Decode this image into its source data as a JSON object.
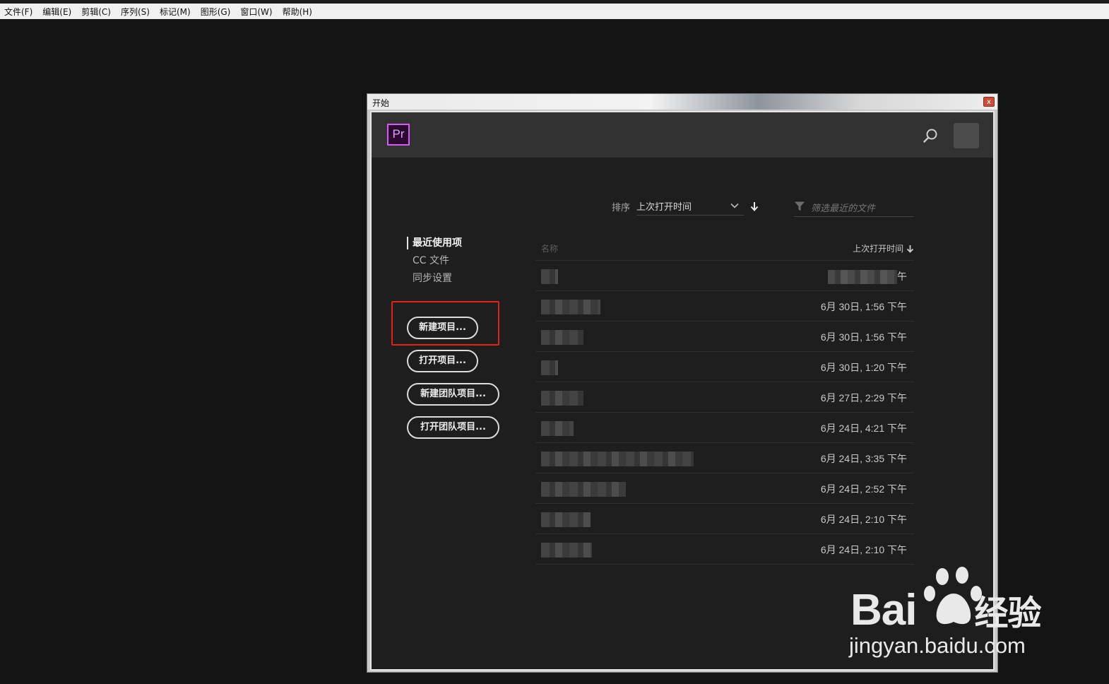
{
  "menubar": {
    "items": [
      "文件(F)",
      "编辑(E)",
      "剪辑(C)",
      "序列(S)",
      "标记(M)",
      "图形(G)",
      "窗口(W)",
      "帮助(H)"
    ]
  },
  "window": {
    "title": "开始",
    "close_label": "x",
    "logo_text": "Pr",
    "logo_color": "#d45cf5"
  },
  "sort": {
    "label": "排序",
    "value": "上次打开时间",
    "filter_placeholder": "筛选最近的文件"
  },
  "nav": {
    "items": [
      "最近使用项",
      "CC 文件",
      "同步设置"
    ]
  },
  "buttons": {
    "new_project": "新建项目...",
    "open_project": "打开项目...",
    "new_team_project": "新建团队项目...",
    "open_team_project": "打开团队项目..."
  },
  "files": {
    "col_name": "名称",
    "col_date": "上次打开时间",
    "rows": [
      {
        "date": "午"
      },
      {
        "date": "6月 30日, 1:56 下午"
      },
      {
        "date": "6月 30日, 1:56 下午"
      },
      {
        "date": "6月 30日, 1:20 下午"
      },
      {
        "date": "6月 27日, 2:29 下午"
      },
      {
        "date": "6月 24日, 4:21 下午"
      },
      {
        "date": "6月 24日, 3:35 下午"
      },
      {
        "date": "6月 24日, 2:52 下午"
      },
      {
        "date": "6月 24日, 2:10 下午"
      },
      {
        "date": "6月 24日, 2:10 下午"
      }
    ]
  },
  "watermark": {
    "brand": "Bai",
    "brand_suffix": "经验",
    "url": "jingyan.baidu.com"
  },
  "colors": {
    "highlight": "#e0231a",
    "panel": "#1e1e1e",
    "header": "#323232"
  }
}
